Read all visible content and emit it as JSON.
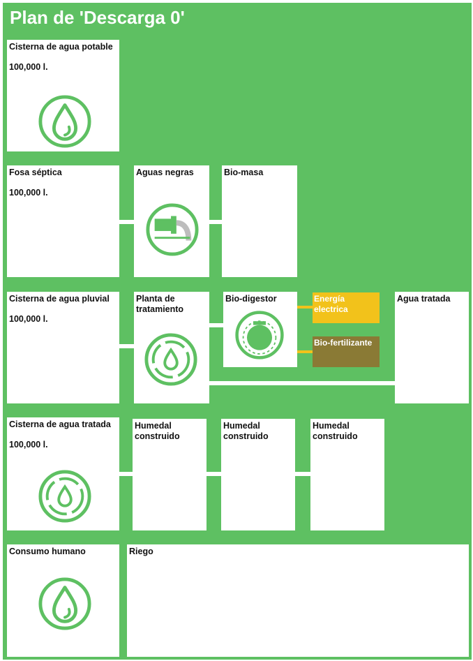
{
  "title": "Plan de 'Descarga 0'",
  "colors": {
    "background": "#5ec062",
    "icon": "#5ec062",
    "box": "#ffffff",
    "energy": "#f2c21b",
    "fertilizer": "#8a7a35"
  },
  "rows": {
    "r1": {
      "potable": {
        "label": "Cisterna de agua potable",
        "volume": "100,000 l.",
        "icon": "water-drop-icon"
      }
    },
    "r2": {
      "septic": {
        "label": "Fosa séptica",
        "volume": "100,000 l."
      },
      "black": {
        "label": "Aguas negras",
        "icon": "pipe-outflow-icon"
      },
      "biomass": {
        "label": "Bio-masa"
      }
    },
    "r3": {
      "rain": {
        "label": "Cisterna de agua pluvial",
        "volume": "100,000 l."
      },
      "plant": {
        "label": "Planta de tratamiento",
        "icon": "recycle-water-icon"
      },
      "digestor": {
        "label": "Bio-digestor",
        "icon": "digestor-tank-icon"
      },
      "energy": {
        "label": "Energía electrica"
      },
      "fertilizer": {
        "label": "Bio-fertilizante"
      },
      "treated": {
        "label": "Agua tratada"
      }
    },
    "r4": {
      "treatedTank": {
        "label": "Cisterna de agua tratada",
        "volume": "100,000 l.",
        "icon": "recycle-water-icon"
      },
      "wetland1": {
        "label": "Humedal construido"
      },
      "wetland2": {
        "label": "Humedal construido"
      },
      "wetland3": {
        "label": "Humedal construido"
      }
    },
    "r5": {
      "consumption": {
        "label": "Consumo humano",
        "icon": "water-drop-icon"
      },
      "irrigation": {
        "label": "Riego"
      }
    }
  }
}
